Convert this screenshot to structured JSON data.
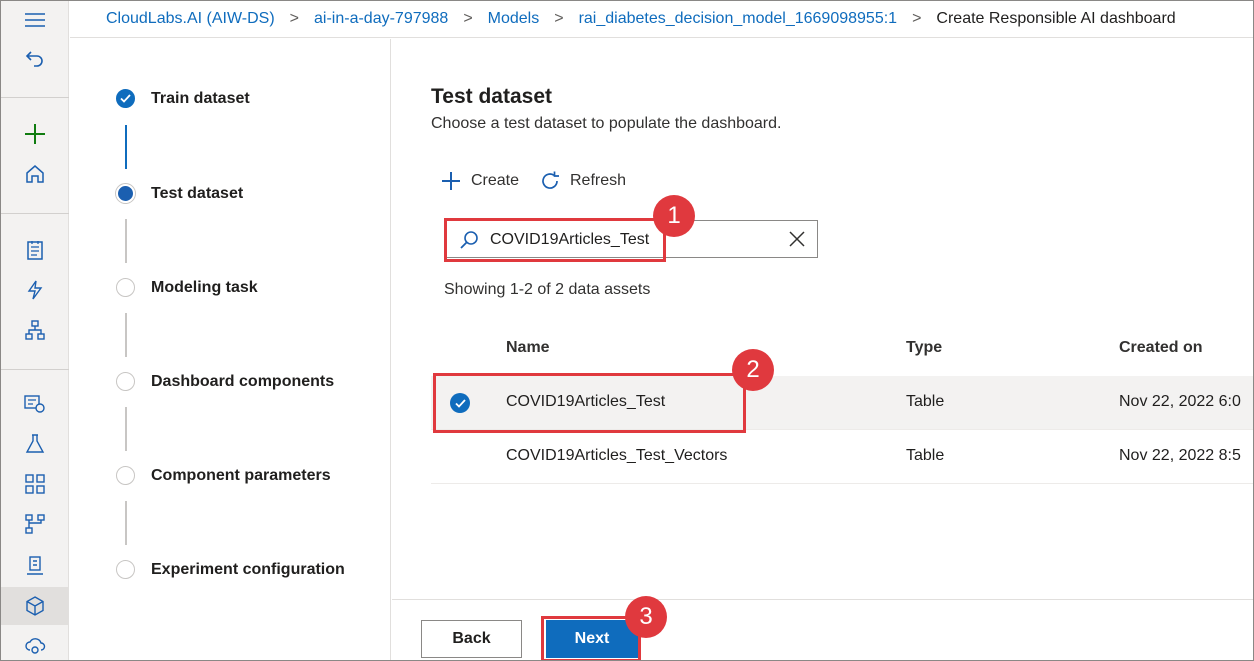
{
  "breadcrumb": {
    "items": [
      "CloudLabs.AI (AIW-DS)",
      "ai-in-a-day-797988",
      "Models",
      "rai_diabetes_decision_model_1669098955:1"
    ],
    "current": "Create Responsible AI dashboard"
  },
  "steps": [
    {
      "label": "Train dataset",
      "state": "done"
    },
    {
      "label": "Test dataset",
      "state": "current"
    },
    {
      "label": "Modeling task",
      "state": "pending"
    },
    {
      "label": "Dashboard components",
      "state": "pending"
    },
    {
      "label": "Component parameters",
      "state": "pending"
    },
    {
      "label": "Experiment configuration",
      "state": "pending"
    }
  ],
  "panel": {
    "title": "Test dataset",
    "subtitle": "Choose a test dataset to populate the dashboard.",
    "create_label": "Create",
    "refresh_label": "Refresh",
    "search_value": "COVID19Articles_Test",
    "count_text": "Showing 1-2 of 2 data assets"
  },
  "table": {
    "columns": [
      "Name",
      "Type",
      "Created on"
    ],
    "rows": [
      {
        "name": "COVID19Articles_Test",
        "type": "Table",
        "created": "Nov 22, 2022 6:0",
        "selected": true
      },
      {
        "name": "COVID19Articles_Test_Vectors",
        "type": "Table",
        "created": "Nov 22, 2022 8:5",
        "selected": false
      }
    ]
  },
  "footer": {
    "back_label": "Back",
    "next_label": "Next"
  },
  "callouts": [
    "1",
    "2",
    "3"
  ],
  "colors": {
    "accent": "#0f6cbd",
    "callout": "#e0393e",
    "add_icon": "#107c10"
  },
  "rail_icons": [
    "hamburger-icon",
    "undo-icon",
    "plus-icon",
    "home-icon",
    "notebook-icon",
    "automl-icon",
    "designer-icon",
    "data-icon",
    "experiment-icon",
    "pipeline-icon",
    "network-icon",
    "compute-icon",
    "models-icon",
    "endpoints-icon"
  ]
}
